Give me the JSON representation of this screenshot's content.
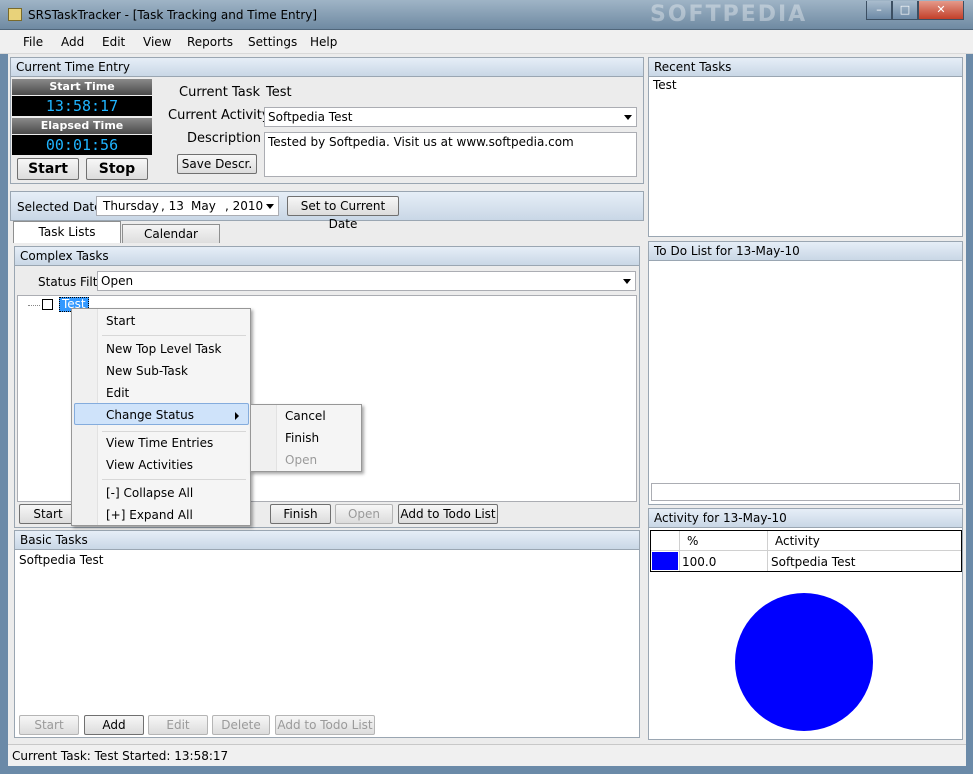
{
  "window": {
    "title": "SRSTaskTracker - [Task Tracking and Time Entry]",
    "watermark": "SOFTPEDIA"
  },
  "menu": [
    "File",
    "Add",
    "Edit",
    "View",
    "Reports",
    "Settings",
    "Help"
  ],
  "time_entry": {
    "header": "Current Time Entry",
    "start_time_label": "Start Time",
    "start_time": "13:58:17",
    "elapsed_label": "Elapsed Time",
    "elapsed": "00:01:56",
    "start_button": "Start",
    "stop_button": "Stop",
    "current_task_label": "Current Task",
    "current_task": "Test",
    "current_activity_label": "Current Activity",
    "current_activity": "Softpedia Test",
    "description_label": "Description",
    "description": "Tested by Softpedia. Visit us at www.softpedia.com",
    "save_descr_button": "Save Descr."
  },
  "date_bar": {
    "label": "Selected Date",
    "weekday": "Thursday",
    "day": ", 13",
    "month": "May",
    "year": ", 2010",
    "set_current_button": "Set to Current Date"
  },
  "tabs": [
    "Task Lists",
    "Calendar"
  ],
  "complex_tasks": {
    "header": "Complex Tasks",
    "status_filter_label": "Status Filter",
    "status_filter": "Open",
    "tree_item": "Test",
    "buttons": {
      "start": "Start",
      "finish": "Finish",
      "open": "Open",
      "add_todo": "Add to Todo List"
    }
  },
  "context_menu": {
    "items": [
      "Start",
      "New Top Level Task",
      "New Sub-Task",
      "Edit",
      "Change Status",
      "View Time Entries",
      "View Activities",
      "[-] Collapse All",
      "[+] Expand All"
    ],
    "submenu": [
      "Cancel",
      "Finish",
      "Open"
    ]
  },
  "basic_tasks": {
    "header": "Basic Tasks",
    "items": [
      "Softpedia Test"
    ],
    "buttons": {
      "start": "Start",
      "add": "Add",
      "edit": "Edit",
      "delete": "Delete",
      "add_todo": "Add to Todo List"
    }
  },
  "recent_tasks": {
    "header": "Recent Tasks",
    "items": [
      "Test"
    ]
  },
  "todo": {
    "header": "To Do List for 13-May-10"
  },
  "activity": {
    "header": "Activity for 13-May-10",
    "col_percent": "%",
    "col_activity": "Activity",
    "rows": [
      {
        "percent": "100.0",
        "activity": "Softpedia Test",
        "color": "#0000ff"
      }
    ]
  },
  "chart_data": {
    "type": "pie",
    "categories": [
      "Softpedia Test"
    ],
    "values": [
      100.0
    ],
    "colors": [
      "#0000ff"
    ]
  },
  "status_bar": {
    "text": "Current Task: Test Started: 13:58:17"
  }
}
